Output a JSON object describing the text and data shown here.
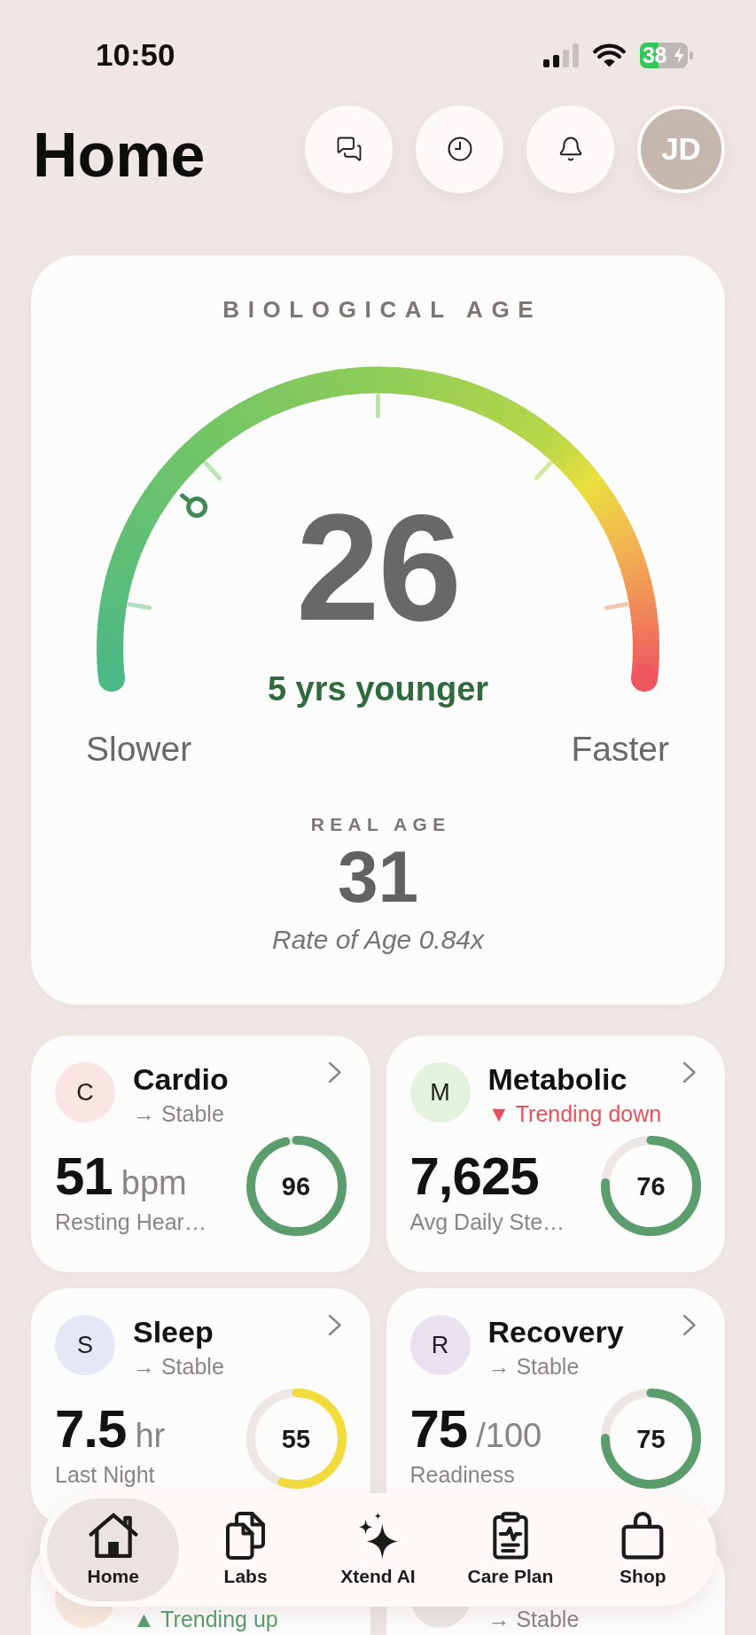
{
  "status_bar": {
    "time": "10:50",
    "battery": "38"
  },
  "header": {
    "title": "Home",
    "avatar": "JD"
  },
  "biological_age": {
    "title": "BIOLOGICAL AGE",
    "value": "26",
    "difference": "5 yrs younger",
    "gauge": {
      "level": 0.23
    },
    "min_label": "Slower",
    "max_label": "Faster",
    "real_age_label": "REAL AGE",
    "real_age": "31",
    "rate": "Rate of Age 0.84x"
  },
  "cards": [
    {
      "letter": "C",
      "color": "#fbe4e4",
      "title": "Cardio",
      "trend": {
        "kind": "stable",
        "text": "→ Stable"
      },
      "value": "51",
      "unit": "bpm",
      "label": "Resting Hear…",
      "score": {
        "text": "96",
        "level": 0.96,
        "color": "#5b9d6d"
      }
    },
    {
      "letter": "M",
      "color": "#e2f2dc",
      "title": "Metabolic",
      "trend": {
        "kind": "down",
        "text": "▼ Trending down"
      },
      "value": "7,625",
      "label": "Avg Daily Ste…",
      "score": {
        "text": "76",
        "level": 0.76,
        "color": "#5b9d6d"
      }
    },
    {
      "letter": "S",
      "color": "#e4e7f5",
      "title": "Sleep",
      "trend": {
        "kind": "stable",
        "text": "→ Stable"
      },
      "value": "7.5",
      "unit": "hr",
      "label": "Last Night",
      "score": {
        "text": "55",
        "level": 0.55,
        "color": "#f2dc3c"
      }
    },
    {
      "letter": "R",
      "color": "#e8e1ef",
      "title": "Recovery",
      "trend": {
        "kind": "stable",
        "text": "→ Stable"
      },
      "value": "75",
      "unit": "/100",
      "label": "Readiness",
      "score": {
        "text": "75",
        "level": 0.75,
        "color": "#5b9d6d"
      }
    },
    {
      "color": "#f8e9de",
      "trend": {
        "kind": "up",
        "text": "▲ Trending up"
      }
    },
    {
      "color": "#ebe7e5",
      "trend": {
        "kind": "stable",
        "text": "→ Stable"
      }
    }
  ],
  "nav": [
    {
      "kind": "home",
      "label": "Home",
      "selected": true
    },
    {
      "kind": "labs",
      "label": "Labs",
      "selected": false
    },
    {
      "kind": "ai",
      "label": "Xtend AI",
      "selected": false
    },
    {
      "kind": "care",
      "label": "Care Plan",
      "selected": false
    },
    {
      "kind": "shop",
      "label": "Shop",
      "selected": false
    }
  ]
}
